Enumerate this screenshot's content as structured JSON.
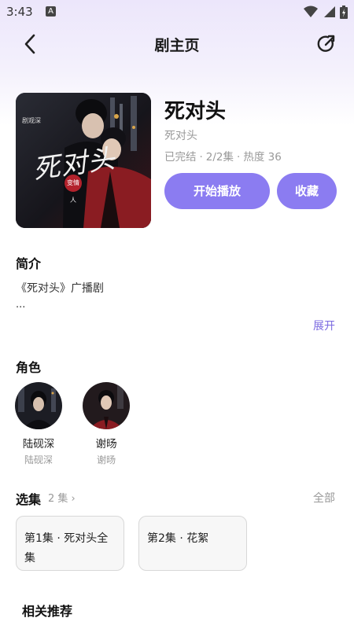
{
  "status_bar": {
    "time": "3:43",
    "app_badge": "A"
  },
  "header": {
    "title": "剧主页"
  },
  "drama": {
    "title": "死对头",
    "subtitle": "死对头",
    "status": "已完结",
    "episodes": "2/2集",
    "popularity": "热度 36",
    "meta_separator": "·",
    "cover": {
      "text": "死对头",
      "badge": "变情人",
      "brand": "剧观深"
    }
  },
  "actions": {
    "play_label": "开始播放",
    "favorite_label": "收藏"
  },
  "intro": {
    "heading": "简介",
    "text": "《死对头》广播剧",
    "ellipsis": "...",
    "expand_label": "展开"
  },
  "roles": {
    "heading": "角色",
    "items": [
      {
        "name": "陆砚深",
        "actor": "陆砚深"
      },
      {
        "name": "谢旸",
        "actor": "谢旸"
      }
    ]
  },
  "episodes": {
    "heading": "选集",
    "count_label": "2 集 ›",
    "all_label": "全部",
    "items": [
      {
        "label": "第1集 · 死对头全集"
      },
      {
        "label": "第2集 · 花絮"
      }
    ]
  },
  "recommend": {
    "heading": "相关推荐"
  },
  "colors": {
    "accent": "#8b7cf1",
    "link": "#7b6ae0",
    "muted": "#999999"
  }
}
